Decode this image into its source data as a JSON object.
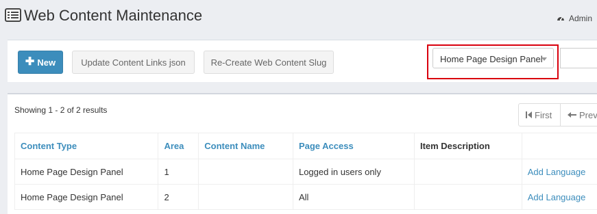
{
  "header": {
    "title": "Web Content Maintenance",
    "title_icon": "list-icon",
    "user_icon": "dashboard-gauge-icon",
    "user_label": "Admin"
  },
  "toolbar": {
    "new_label": "New",
    "update_label": "Update Content Links json",
    "slug_label": "Re-Create Web Content Slug",
    "content_type_select": "Home Page Design Panel",
    "filter_value": ""
  },
  "results": {
    "summary": "Showing 1 - 2 of 2 results",
    "pager_first": "First",
    "pager_prev": "Prev"
  },
  "table": {
    "headers": [
      "Content Type",
      "Area",
      "Content Name",
      "Page Access",
      "Item Description",
      ""
    ],
    "rows": [
      {
        "content_type": "Home Page Design Panel",
        "area": "1",
        "content_name": "",
        "page_access": "Logged in users only",
        "item_description": "",
        "action": "Add Language"
      },
      {
        "content_type": "Home Page Design Panel",
        "area": "2",
        "content_name": "",
        "page_access": "All",
        "item_description": "",
        "action": "Add Language"
      }
    ]
  },
  "colors": {
    "primary": "#3c8dbc",
    "highlight_border": "#d9000d",
    "background": "#eceef2"
  }
}
